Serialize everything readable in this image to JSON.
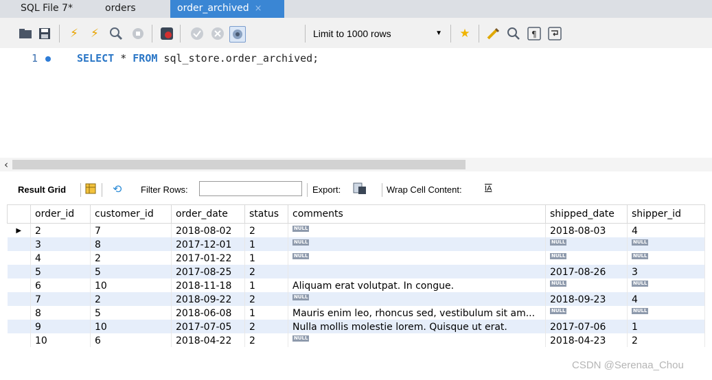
{
  "tabs": [
    {
      "label": "SQL File 7*"
    },
    {
      "label": "orders"
    },
    {
      "label": "order_archived",
      "close": "×"
    }
  ],
  "toolbar": {
    "limit_label": "Limit to 1000 rows",
    "icons": [
      "open-folder-icon",
      "save-icon",
      "execute-icon",
      "execute-current-icon",
      "explain-icon",
      "stop-icon",
      "toggle-error-icon",
      "commit-icon",
      "rollback-icon",
      "autocommit-icon",
      "beautify-icon",
      "bookmark-icon",
      "clean-icon",
      "find-icon",
      "invisible-chars-icon",
      "wrap-icon"
    ]
  },
  "editor": {
    "line_number": "1",
    "query": {
      "kw1": "SELECT",
      "star": " * ",
      "kw2": "FROM",
      "rest": " sql_store.order_archived;"
    }
  },
  "result_toolbar": {
    "result_grid": "Result Grid",
    "filter_rows": "Filter Rows:",
    "export": "Export:",
    "wrap": "Wrap Cell Content:"
  },
  "grid": {
    "columns": [
      "order_id",
      "customer_id",
      "order_date",
      "status",
      "comments",
      "shipped_date",
      "shipper_id"
    ],
    "null_label": "NULL",
    "rows": [
      {
        "order_id": "2",
        "customer_id": "7",
        "order_date": "2018-08-02",
        "status": "2",
        "comments": null,
        "shipped_date": "2018-08-03",
        "shipper_id": "4"
      },
      {
        "order_id": "3",
        "customer_id": "8",
        "order_date": "2017-12-01",
        "status": "1",
        "comments": null,
        "shipped_date": null,
        "shipper_id": null
      },
      {
        "order_id": "4",
        "customer_id": "2",
        "order_date": "2017-01-22",
        "status": "1",
        "comments": null,
        "shipped_date": null,
        "shipper_id": null
      },
      {
        "order_id": "5",
        "customer_id": "5",
        "order_date": "2017-08-25",
        "status": "2",
        "comments": "",
        "shipped_date": "2017-08-26",
        "shipper_id": "3"
      },
      {
        "order_id": "6",
        "customer_id": "10",
        "order_date": "2018-11-18",
        "status": "1",
        "comments": "Aliquam erat volutpat. In congue.",
        "shipped_date": null,
        "shipper_id": null
      },
      {
        "order_id": "7",
        "customer_id": "2",
        "order_date": "2018-09-22",
        "status": "2",
        "comments": null,
        "shipped_date": "2018-09-23",
        "shipper_id": "4"
      },
      {
        "order_id": "8",
        "customer_id": "5",
        "order_date": "2018-06-08",
        "status": "1",
        "comments": "Mauris enim leo, rhoncus sed, vestibulum sit am...",
        "shipped_date": null,
        "shipper_id": null
      },
      {
        "order_id": "9",
        "customer_id": "10",
        "order_date": "2017-07-05",
        "status": "2",
        "comments": "Nulla mollis molestie lorem. Quisque ut erat.",
        "shipped_date": "2017-07-06",
        "shipper_id": "1"
      },
      {
        "order_id": "10",
        "customer_id": "6",
        "order_date": "2018-04-22",
        "status": "2",
        "comments": null,
        "shipped_date": "2018-04-23",
        "shipper_id": "2"
      }
    ]
  },
  "watermark": "CSDN @Serenaa_Chou"
}
